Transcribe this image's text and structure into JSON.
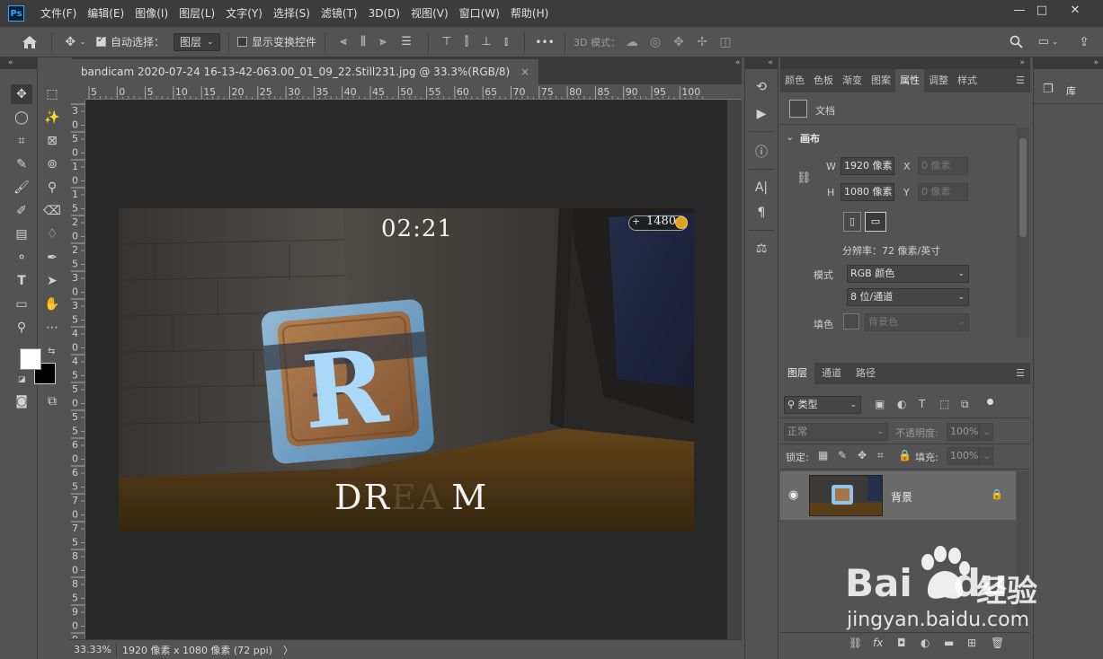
{
  "app": {
    "logo": "Ps"
  },
  "menu": [
    "文件(F)",
    "编辑(E)",
    "图像(I)",
    "图层(L)",
    "文字(Y)",
    "选择(S)",
    "滤镜(T)",
    "3D(D)",
    "视图(V)",
    "窗口(W)",
    "帮助(H)"
  ],
  "window_controls": {
    "minimize": "—",
    "maximize": "□",
    "close": "✕"
  },
  "options": {
    "auto_select_label": "自动选择：",
    "auto_select_checked": true,
    "auto_select_target": "图层",
    "show_transform_label": "显示变换控件",
    "show_transform_checked": false,
    "mode_3d_label": "3D 模式：",
    "more": "•••"
  },
  "document": {
    "tab_title": "bandicam 2020-07-24 16-13-42-063.00_01_09_22.Still231.jpg @ 33.3%(RGB/8)",
    "tab_close": "×",
    "zoom": "33.33%",
    "info": "1920 像素 x 1080 像素 (72 ppi)",
    "info_arrow": "〉"
  },
  "rulers": {
    "h_ticks": [
      "5",
      "0",
      "5",
      "10",
      "15",
      "20",
      "25",
      "30",
      "35",
      "40",
      "45",
      "50",
      "55",
      "60",
      "65",
      "70",
      "75",
      "80",
      "85",
      "90",
      "95",
      "100"
    ],
    "v_ticks": [
      "3",
      "0",
      "5",
      "0",
      "1",
      "0",
      "1",
      "5",
      "2",
      "0",
      "2",
      "5",
      "3",
      "0",
      "3",
      "5",
      "4",
      "0",
      "4",
      "5",
      "5",
      "0",
      "5",
      "5",
      "6",
      "0",
      "6",
      "5",
      "7",
      "0",
      "7",
      "5",
      "8",
      "0",
      "8",
      "5",
      "9",
      "0",
      "9",
      "5",
      "1",
      "0"
    ]
  },
  "canvas_art": {
    "timer": "02:21",
    "coins_plus": "+",
    "coins": "1480",
    "cube_letter": "R",
    "cube_ghost_letter": "D",
    "word_left": "DR",
    "word_mid": "EA",
    "word_right": "M",
    "colors": {
      "cube_frame": "#7fbfef",
      "wood": "#b07a4c",
      "letter": "#a9d8f8",
      "floor": "#6b4a1c"
    }
  },
  "properties": {
    "tabs": [
      "颜色",
      "色板",
      "渐变",
      "图案",
      "属性",
      "调整",
      "样式"
    ],
    "active_tab": "属性",
    "section_doc": "文档",
    "section_canvas": "画布",
    "w_label": "W",
    "w_value": "1920 像素",
    "h_label": "H",
    "h_value": "1080 像素",
    "x_label": "X",
    "x_value": "0 像素",
    "y_label": "Y",
    "y_value": "0 像素",
    "resolution": "分辨率：72 像素/英寸",
    "mode_label": "模式",
    "mode_value": "RGB 颜色",
    "depth_value": "8 位/通道",
    "fill_label": "填色",
    "fill_value": "背景色"
  },
  "layers": {
    "tabs": [
      "图层",
      "通道",
      "路径"
    ],
    "active_tab": "图层",
    "filter_label": "类型",
    "blend_mode": "正常",
    "opacity_label": "不透明度:",
    "opacity_value": "100%",
    "lock_label": "锁定:",
    "fill_label": "填充:",
    "fill_value": "100%",
    "items": [
      {
        "name": "背景",
        "visible": true,
        "locked": true
      }
    ],
    "footer_icons": [
      "link-icon",
      "fx-icon",
      "mask-icon",
      "adjustment-icon",
      "group-icon",
      "new-layer-icon",
      "trash-icon"
    ],
    "fx_text": "fx"
  },
  "library": {
    "label": "库"
  },
  "watermark": {
    "brand": "Bai",
    "brand2": "du",
    "cn": "经验",
    "url": "jingyan.baidu.com"
  }
}
